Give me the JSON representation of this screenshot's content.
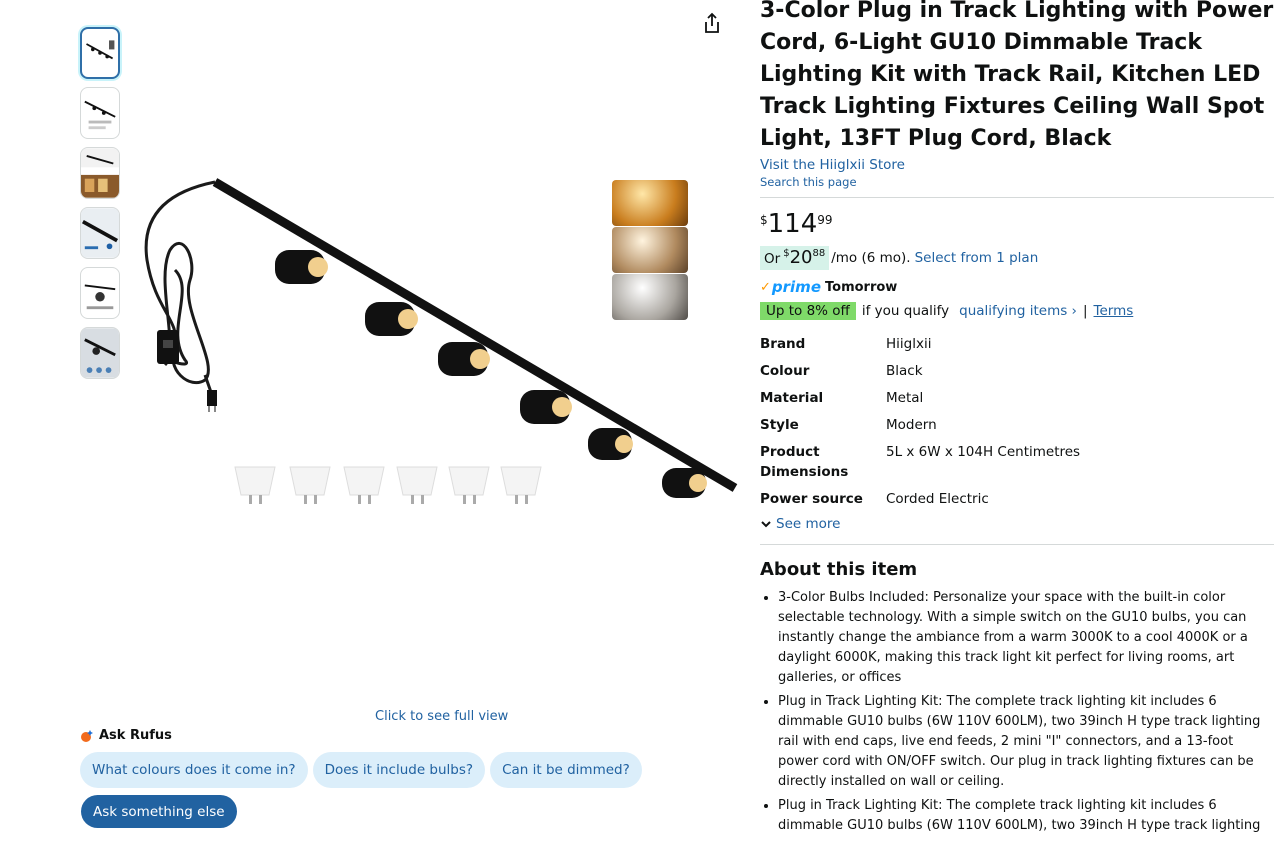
{
  "product": {
    "title": "3-Color Plug in Track Lighting with Power Cord, 6-Light GU10 Dimmable Track Lighting Kit with Track Rail, Kitchen LED Track Lighting Fixtures Ceiling Wall Spot Light, 13FT Plug Cord, Black",
    "store_link": "Visit the Hiiglxii Store",
    "search_page": "Search this page"
  },
  "price": {
    "symbol": "$",
    "whole": "114",
    "fraction": "99",
    "monthly_prefix": "Or",
    "monthly_symbol": "$",
    "monthly_whole": "20",
    "monthly_fraction": "88",
    "monthly_suffix": "/mo (6 mo).",
    "plan_link": "Select from 1 plan"
  },
  "delivery": {
    "prime_label": "prime",
    "delivery_day": "Tomorrow"
  },
  "deal": {
    "badge": "Up to 8% off",
    "qualify_text": "if you qualify",
    "qualifying_link": "qualifying items ›",
    "separator": "|",
    "terms_link": "Terms"
  },
  "specs": [
    {
      "key": "Brand",
      "value": "Hiiglxii"
    },
    {
      "key": "Colour",
      "value": "Black"
    },
    {
      "key": "Material",
      "value": "Metal"
    },
    {
      "key": "Style",
      "value": "Modern"
    },
    {
      "key": "Product Dimensions",
      "value": "5L x 6W x 104H Centimetres"
    },
    {
      "key": "Power source",
      "value": "Corded Electric"
    }
  ],
  "see_more": "See more",
  "about": {
    "heading": "About this item",
    "bullets": [
      "3-Color Bulbs Included: Personalize your space with the built-in color selectable technology. With a simple switch on the GU10 bulbs, you can instantly change the ambiance from a warm 3000K to a cool 4000K or a daylight 6000K, making this track light kit perfect for living rooms, art galleries, or offices",
      "Plug in Track Lighting Kit: The complete track lighting kit includes 6 dimmable GU10 bulbs (6W 110V 600LM), two 39inch H type track lighting rail with end caps, live end feeds, 2 mini \"I\" connectors, and a 13-foot power cord with ON/OFF switch. Our plug in track lighting fixtures can be directly installed on wall or ceiling.",
      "Plug in Track Lighting Kit: The complete track lighting kit includes 6 dimmable GU10 bulbs (6W 110V 600LM), two 39inch H type track lighting"
    ]
  },
  "gallery": {
    "full_view": "Click to see full view",
    "thumbnail_count": 6
  },
  "rufus": {
    "title": "Ask Rufus",
    "chips": [
      "What colours does it come in?",
      "Does it include bulbs?",
      "Can it be dimmed?"
    ],
    "ask_else": "Ask something else"
  },
  "colors": {
    "link": "#2162a1",
    "deal_badge": "#7fda69",
    "monthly_badge": "#d6f2e9",
    "chip_bg": "#dbeefa",
    "ask_button": "#2162a1",
    "prime": "#1399ff"
  },
  "icons": {
    "share": "share-icon",
    "rufus": "rufus-logo-icon",
    "chevron": "chevron-down-icon",
    "prime_check": "prime-check-icon"
  }
}
